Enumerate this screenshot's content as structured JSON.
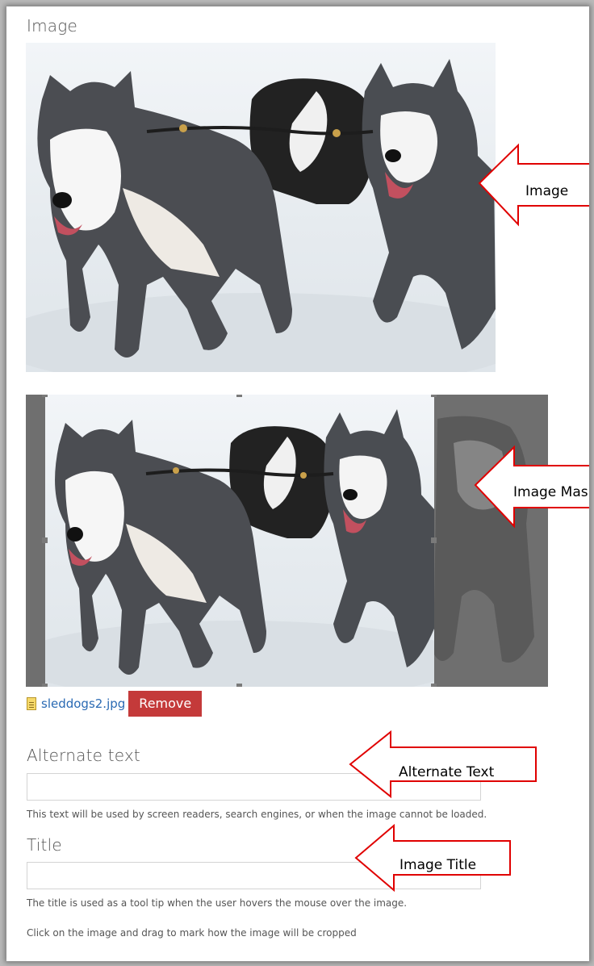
{
  "image_field": {
    "label": "Image",
    "file_name": "sleddogs2.jpg",
    "remove_label": "Remove"
  },
  "alt_field": {
    "label": "Alternate text",
    "value": "",
    "help": "This text will be used by screen readers, search engines, or when the image cannot be loaded."
  },
  "title_field": {
    "label": "Title",
    "value": "",
    "help": "The title is used as a tool tip when the user hovers the mouse over the image."
  },
  "crop_instruction": "Click on the image and drag to mark how the image will be cropped",
  "annotations": {
    "image": "Image",
    "image_mask": "Image Mask",
    "alternate_text": "Alternate Text",
    "image_title": "Image Title",
    "arrow_color": "#e00000"
  },
  "colors": {
    "remove_button": "#c43a3a",
    "link": "#2a6ab3"
  }
}
